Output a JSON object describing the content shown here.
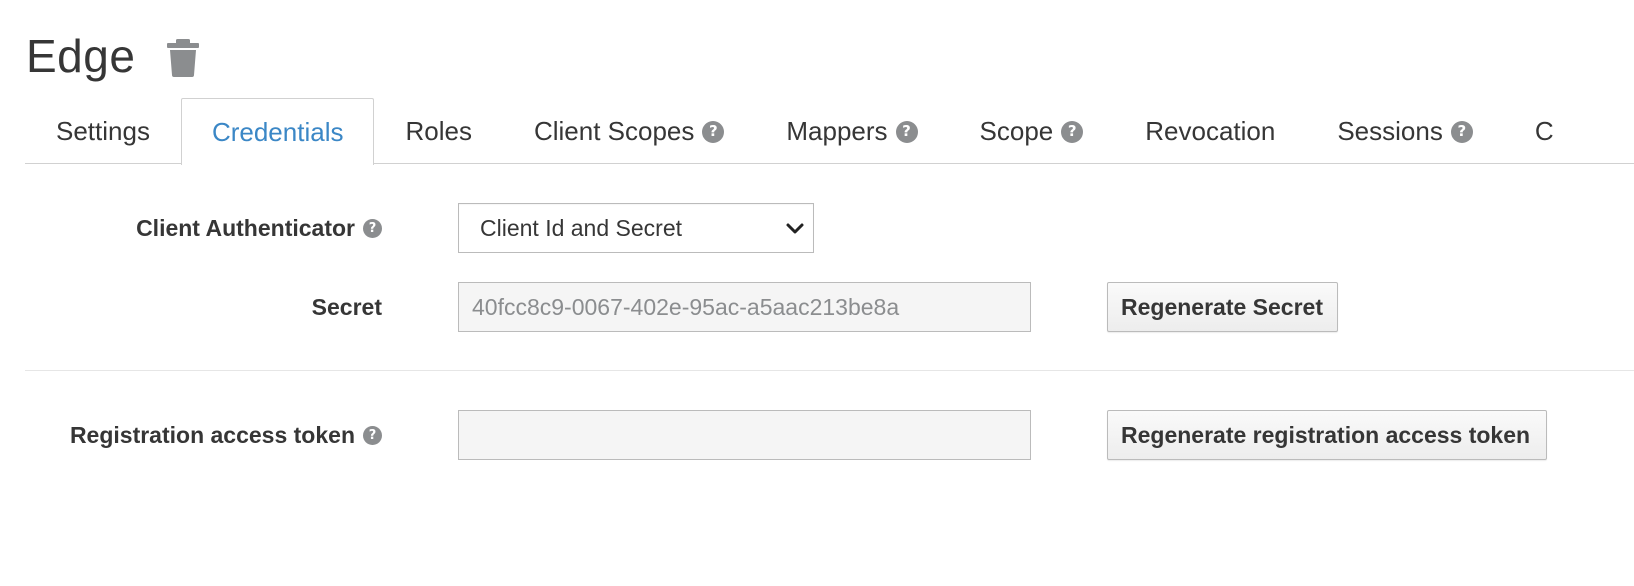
{
  "header": {
    "title": "Edge",
    "delete_icon": "trash-icon"
  },
  "tabs": [
    {
      "label": "Settings",
      "active": false,
      "help": false
    },
    {
      "label": "Credentials",
      "active": true,
      "help": false
    },
    {
      "label": "Roles",
      "active": false,
      "help": false
    },
    {
      "label": "Client Scopes",
      "active": false,
      "help": true
    },
    {
      "label": "Mappers",
      "active": false,
      "help": true
    },
    {
      "label": "Scope",
      "active": false,
      "help": true
    },
    {
      "label": "Revocation",
      "active": false,
      "help": false
    },
    {
      "label": "Sessions",
      "active": false,
      "help": true
    },
    {
      "label": "C",
      "active": false,
      "help": false
    }
  ],
  "form": {
    "client_authenticator": {
      "label": "Client Authenticator",
      "selected": "Client Id and Secret"
    },
    "secret": {
      "label": "Secret",
      "value": "40fcc8c9-0067-402e-95ac-a5aac213be8a",
      "button": "Regenerate Secret"
    },
    "registration_token": {
      "label": "Registration access token",
      "value": "",
      "button": "Regenerate registration access token"
    }
  },
  "icons": {
    "help": "?"
  },
  "colors": {
    "accent": "#3b87c6",
    "text": "#363636",
    "help_icon": "#8b8d8f",
    "input_bg": "#f5f5f5",
    "border": "#bbbbbb"
  }
}
